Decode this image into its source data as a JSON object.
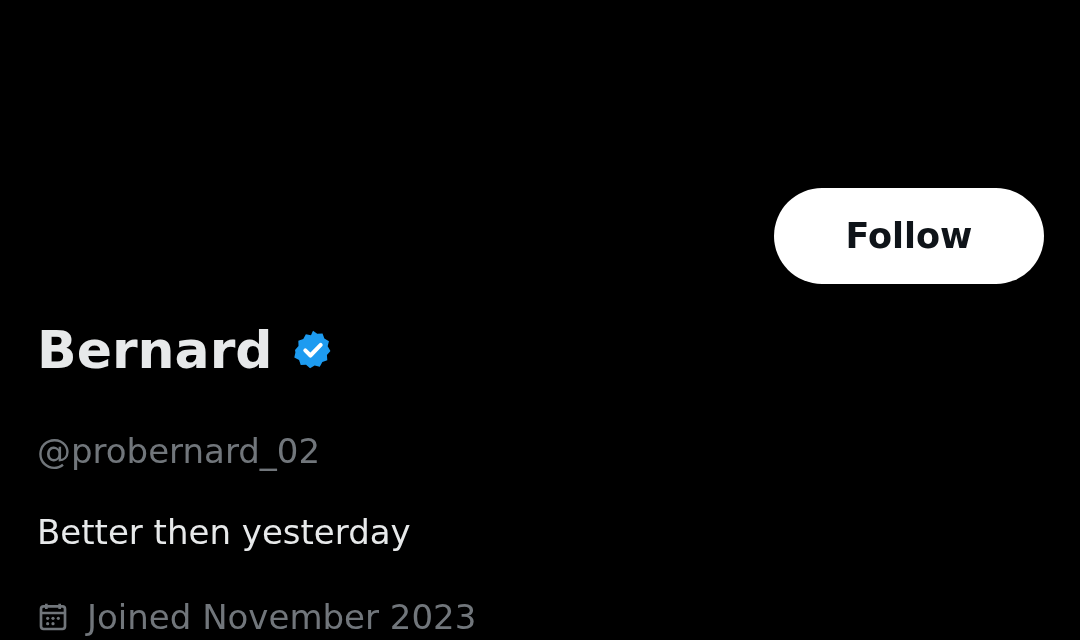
{
  "profile": {
    "name": "Bernard",
    "verified": true,
    "handle": "@probernard_02",
    "bio": "Better then yesterday",
    "joined": "Joined November 2023"
  },
  "follow_button": {
    "label": "Follow"
  }
}
